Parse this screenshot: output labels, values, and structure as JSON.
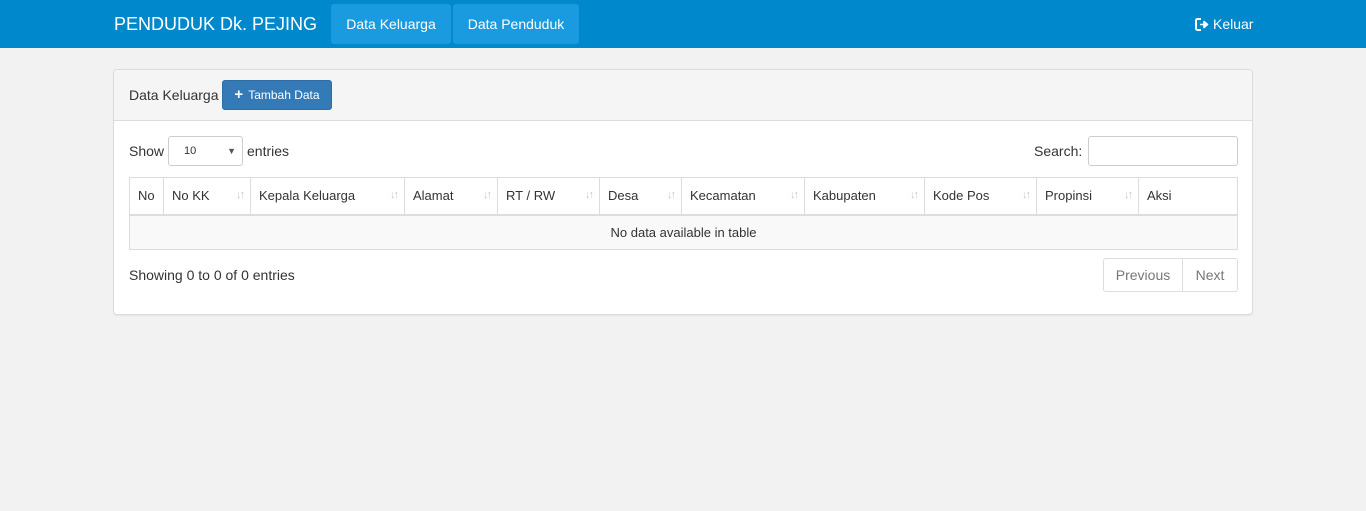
{
  "colors": {
    "navbar": "#0088cc",
    "nav_active": "#1a9be0",
    "primary_button": "#337ab7",
    "page_background": "#f2f2f2"
  },
  "navbar": {
    "brand": "PENDUDUK Dk. PEJING",
    "links": [
      {
        "label": "Data Keluarga"
      },
      {
        "label": "Data Penduduk"
      }
    ],
    "logout": {
      "icon": "sign-out-icon",
      "label": "Keluar"
    }
  },
  "panel": {
    "title": "Data Keluarga",
    "add_button": {
      "icon": "plus-icon",
      "label": "Tambah Data"
    }
  },
  "datatable": {
    "show_label": "Show",
    "page_size": "10",
    "entries_label": "entries",
    "search_label": "Search:",
    "search_value": "",
    "columns": [
      "No",
      "No KK",
      "Kepala Keluarga",
      "Alamat",
      "RT / RW",
      "Desa",
      "Kecamatan",
      "Kabupaten",
      "Kode Pos",
      "Propinsi",
      "Aksi"
    ],
    "empty_message": "No data available in table",
    "info": "Showing 0 to 0 of 0 entries",
    "pagination": {
      "previous": "Previous",
      "next": "Next"
    }
  }
}
